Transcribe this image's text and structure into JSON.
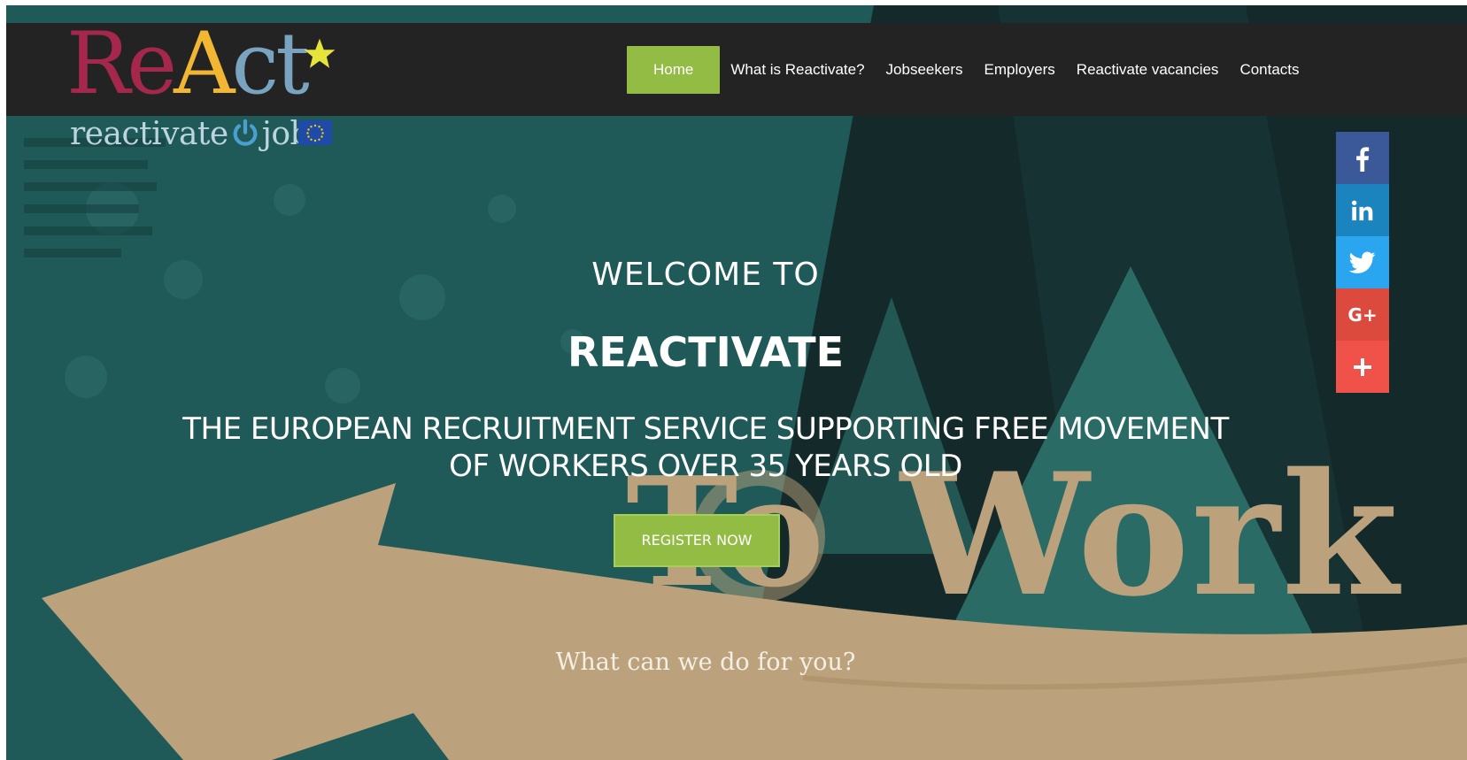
{
  "logo": {
    "part1": "Re",
    "part2": "A",
    "part3": "ct",
    "subtitle_left": "reactivate",
    "subtitle_right": "job",
    "colors": {
      "re": "#a5284c",
      "a": "#f2b732",
      "ct": "#7aa3bf",
      "star": "#e6e43a"
    }
  },
  "nav": {
    "items": [
      "Home",
      "What is Reactivate?",
      "Jobseekers",
      "Employers",
      "Reactivate vacancies",
      "Contacts"
    ],
    "active": "Home"
  },
  "social": [
    {
      "icon": "facebook-icon",
      "color": "#3b5898"
    },
    {
      "icon": "linkedin-icon",
      "color": "#1b84bf"
    },
    {
      "icon": "twitter-icon",
      "color": "#2aa6f0"
    },
    {
      "icon": "google-plus-icon",
      "label": "G+",
      "color": "#db4a3d"
    },
    {
      "icon": "plus-icon",
      "color": "#f0524a"
    }
  ],
  "hero": {
    "welcome": "WELCOME TO",
    "brand": "REACTIVATE",
    "tagline_line1": "THE EUROPEAN RECRUITMENT SERVICE SUPPORTING FREE MOVEMENT",
    "tagline_line2": "OF WORKERS OVER 35 YEARS OLD",
    "register_label": "REGISTER NOW",
    "cta": "What can we do for you?",
    "background_art_text": "To Work"
  },
  "colors": {
    "accent_green": "#93bc45",
    "topbar": "#232323",
    "teal": "#1f5a58",
    "sand": "#bba27c"
  }
}
